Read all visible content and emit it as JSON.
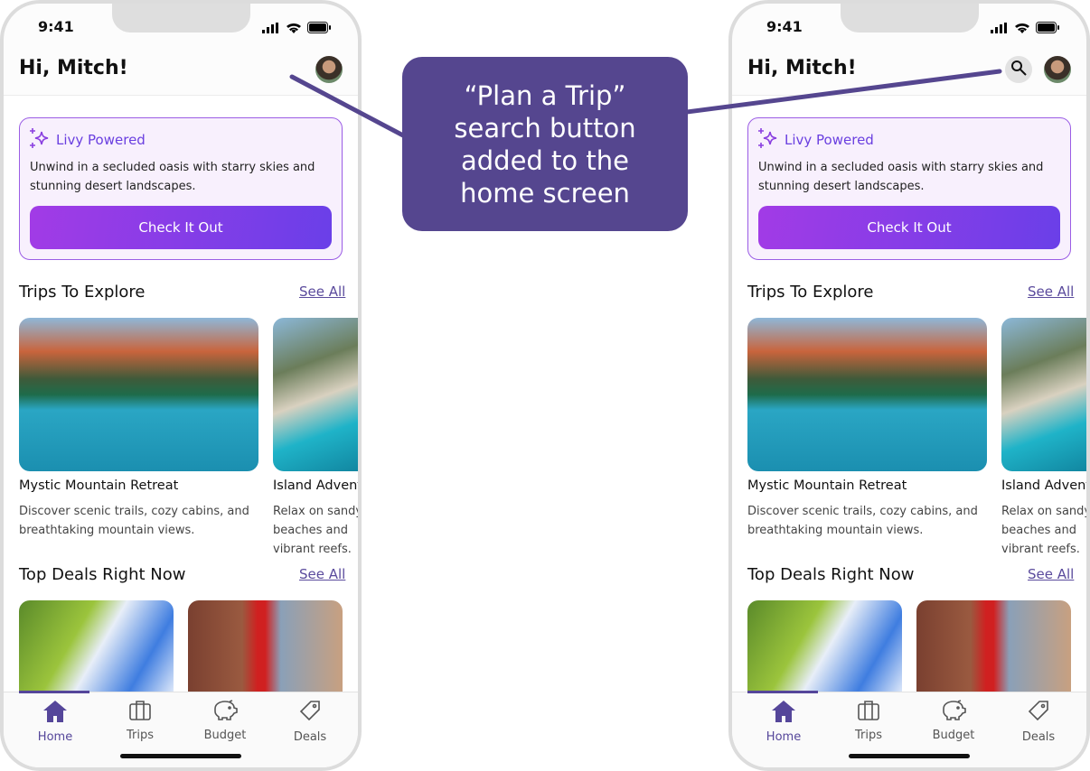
{
  "phones": [
    {
      "variant": "before",
      "status": {
        "time": "9:41"
      },
      "header": {
        "greeting": "Hi, Mitch!",
        "has_search": false
      },
      "livy": {
        "label": "Livy Powered",
        "text": "Unwind in a secluded oasis with starry skies and stunning desert landscapes.",
        "button": "Check It Out"
      },
      "trips": {
        "title": "Trips To Explore",
        "see_all": "See All",
        "items": [
          {
            "title": "Mystic Mountain Retreat",
            "desc": "Discover scenic trails, cozy cabins, and breathtaking mountain views."
          },
          {
            "title": "Island Adventure",
            "desc": "Relax on sandy beaches and vibrant reefs."
          }
        ]
      },
      "deals": {
        "title": "Top Deals Right Now",
        "see_all": "See All"
      },
      "tabs": [
        {
          "label": "Home",
          "icon": "home-icon"
        },
        {
          "label": "Trips",
          "icon": "suitcase-icon"
        },
        {
          "label": "Budget",
          "icon": "piggy-bank-icon"
        },
        {
          "label": "Deals",
          "icon": "tag-icon"
        }
      ]
    },
    {
      "variant": "after",
      "status": {
        "time": "9:41"
      },
      "header": {
        "greeting": "Hi, Mitch!",
        "has_search": true
      },
      "livy": {
        "label": "Livy Powered",
        "text": "Unwind in a secluded oasis with starry skies and stunning desert landscapes.",
        "button": "Check It Out"
      },
      "trips": {
        "title": "Trips To Explore",
        "see_all": "See All",
        "items": [
          {
            "title": "Mystic Mountain Retreat",
            "desc": "Discover scenic trails, cozy cabins, and breathtaking mountain views."
          },
          {
            "title": "Island Adventure",
            "desc": "Relax on sandy beaches and vibrant reefs."
          }
        ]
      },
      "deals": {
        "title": "Top Deals Right Now",
        "see_all": "See All"
      },
      "tabs": [
        {
          "label": "Home",
          "icon": "home-icon"
        },
        {
          "label": "Trips",
          "icon": "suitcase-icon"
        },
        {
          "label": "Budget",
          "icon": "piggy-bank-icon"
        },
        {
          "label": "Deals",
          "icon": "tag-icon"
        }
      ]
    }
  ],
  "callout": {
    "text": "“Plan a Trip” search button added to the home screen"
  },
  "colors": {
    "accent": "#55469a",
    "callout": "#55468f",
    "gradient_start": "#a23be6",
    "gradient_end": "#6a3fe8"
  }
}
